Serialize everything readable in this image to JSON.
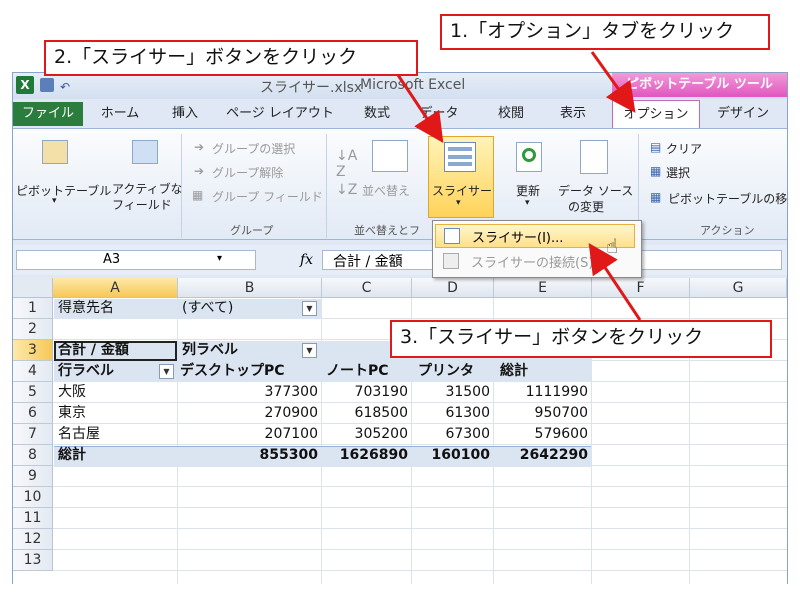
{
  "window": {
    "app_logo": "X",
    "title_left": "スライサー.xlsx",
    "title": "Microsoft Excel",
    "context_tab_group": "ピボットテーブル ツール"
  },
  "tabs": [
    {
      "label": "ファイル"
    },
    {
      "label": "ホーム"
    },
    {
      "label": "挿入"
    },
    {
      "label": "ページ レイアウト"
    },
    {
      "label": "数式"
    },
    {
      "label": "データ"
    },
    {
      "label": "校閲"
    },
    {
      "label": "表示"
    },
    {
      "label": "オプション"
    },
    {
      "label": "デザイン"
    }
  ],
  "ribbon": {
    "pivottable_label": "ピボットテーブル",
    "active_field_label_1": "アクティブな",
    "active_field_label_2": "フィールド",
    "group_select": "グループの選択",
    "group_ungroup": "グループ解除",
    "group_field": "グループ フィールド",
    "group_caption": "グループ",
    "sort_label": "並べ替え",
    "sort_group_caption": "並べ替えとフ",
    "slicer_label": "スライサー",
    "refresh_label": "更新",
    "change_source_1": "データ ソース",
    "change_source_2": "の変更",
    "clear_label": "クリア",
    "select_label": "選択",
    "move_label": "ピボットテーブルの移",
    "action_caption": "アクション"
  },
  "dropdown": {
    "item1": "スライサー(I)...",
    "item2": "スライサーの接続(S)..."
  },
  "formula_bar": {
    "name_box": "A3",
    "fx": "fx",
    "formula": "合計 / 金額"
  },
  "grid": {
    "columns": [
      "A",
      "B",
      "C",
      "D",
      "E",
      "F",
      "G"
    ],
    "rows": [
      "1",
      "2",
      "3",
      "4",
      "5",
      "6",
      "7",
      "8",
      "9",
      "10",
      "11",
      "12",
      "13"
    ],
    "r1": {
      "a": "得意先名",
      "b": "(すべて)"
    },
    "r3": {
      "a": "合計 / 金額",
      "b": "列ラベル"
    },
    "r4": {
      "a": "行ラベル",
      "b": "デスクトップPC",
      "c": "ノートPC",
      "d": "プリンタ",
      "e": "総計"
    },
    "r5": {
      "a": "大阪",
      "b": "377300",
      "c": "703190",
      "d": "31500",
      "e": "1111990"
    },
    "r6": {
      "a": "東京",
      "b": "270900",
      "c": "618500",
      "d": "61300",
      "e": "950700"
    },
    "r7": {
      "a": "名古屋",
      "b": "207100",
      "c": "305200",
      "d": "67300",
      "e": "579600"
    },
    "r8": {
      "a": "総計",
      "b": "855300",
      "c": "1626890",
      "d": "160100",
      "e": "2642290"
    }
  },
  "callouts": {
    "step1": "1.「オプション」タブをクリック",
    "step2": "2.「スライサー」ボタンをクリック",
    "step3": "3.「スライサー」ボタンをクリック"
  },
  "colors": {
    "callout_border": "#e01818",
    "file_tab": "#2a7d3c",
    "pivot_tools": "#e056c0",
    "highlight": "#ffd35a"
  }
}
